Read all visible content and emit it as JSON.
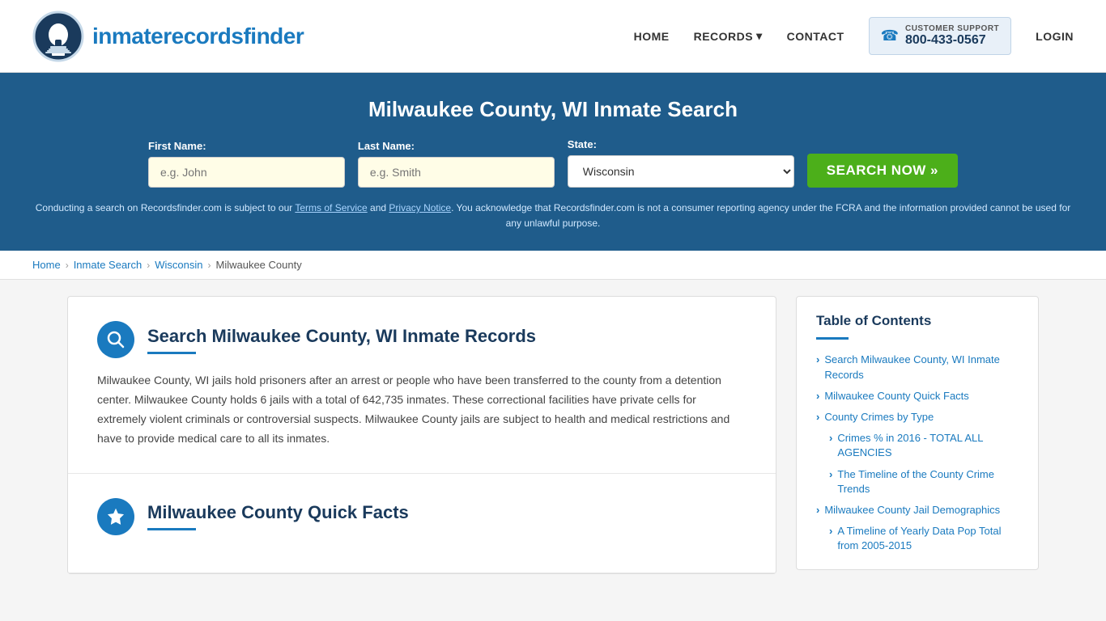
{
  "site": {
    "logo_text_plain": "inmaterecords",
    "logo_text_bold": "finder",
    "logo_alt": "InmateRecordsFinder logo"
  },
  "nav": {
    "home": "HOME",
    "records": "RECORDS",
    "records_arrow": "▾",
    "contact": "CONTACT",
    "support_label": "CUSTOMER SUPPORT",
    "support_number": "800-433-0567",
    "login": "LOGIN"
  },
  "hero": {
    "title": "Milwaukee County, WI Inmate Search",
    "first_name_label": "First Name:",
    "first_name_placeholder": "e.g. John",
    "last_name_label": "Last Name:",
    "last_name_placeholder": "e.g. Smith",
    "state_label": "State:",
    "state_value": "Wisconsin",
    "search_button": "SEARCH NOW »",
    "disclaimer": "Conducting a search on Recordsfinder.com is subject to our Terms of Service and Privacy Notice. You acknowledge that Recordsfinder.com is not a consumer reporting agency under the FCRA and the information provided cannot be used for any unlawful purpose.",
    "tos_link": "Terms of Service",
    "privacy_link": "Privacy Notice"
  },
  "breadcrumb": {
    "home": "Home",
    "inmate_search": "Inmate Search",
    "state": "Wisconsin",
    "county": "Milwaukee County"
  },
  "main_section": {
    "title": "Search Milwaukee County, WI Inmate Records",
    "body": "Milwaukee County, WI jails hold prisoners after an arrest or people who have been transferred to the county from a detention center. Milwaukee County holds 6 jails with a total of 642,735 inmates. These correctional facilities have private cells for extremely violent criminals or controversial suspects. Milwaukee County jails are subject to health and medical restrictions and have to provide medical care to all its inmates."
  },
  "quick_facts_section": {
    "title": "Milwaukee County Quick Facts"
  },
  "toc": {
    "title": "Table of Contents",
    "items": [
      {
        "label": "Search Milwaukee County, WI Inmate Records",
        "indent": false
      },
      {
        "label": "Milwaukee County Quick Facts",
        "indent": false
      },
      {
        "label": "County Crimes by Type",
        "indent": false
      },
      {
        "label": "Crimes % in 2016 - TOTAL ALL AGENCIES",
        "indent": true
      },
      {
        "label": "The Timeline of the County Crime Trends",
        "indent": true
      },
      {
        "label": "Milwaukee County Jail Demographics",
        "indent": false
      },
      {
        "label": "A Timeline of Yearly Data Pop Total from 2005-2015",
        "indent": true
      }
    ]
  }
}
